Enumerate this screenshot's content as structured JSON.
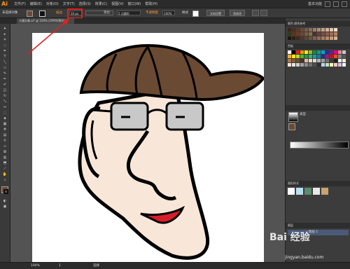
{
  "app": {
    "logo": "Ai"
  },
  "menubar": {
    "items": [
      "文件(F)",
      "编辑(E)",
      "对象(O)",
      "文字(T)",
      "选择(S)",
      "效果(C)",
      "视图(V)",
      "窗口(W)",
      "帮助(H)"
    ],
    "workspace": "基本功能"
  },
  "control_bar": {
    "selection": "未选择对象",
    "stroke_label": "描边",
    "stroke_value": "10 px",
    "profile_label": "等比",
    "brush_label": "5 点圆形",
    "opacity_label": "不透明度",
    "opacity_value": "100%",
    "style_label": "样式",
    "doc_settings": "文档设置",
    "preferences": "首选项"
  },
  "document_tab": {
    "label": "卡通头像.ai* @ 100% (CMYK/预览)"
  },
  "panels": {
    "color_tabs": "颜色  颜色参考",
    "swatches_title": "色板",
    "gradient_type_label": "类型",
    "stroke_title": "描边",
    "graphic_styles_title": "图形样式",
    "layers_title": "图层",
    "layer_name": "图层 1"
  },
  "statusbar": {
    "zoom": "100%",
    "page": "1",
    "tool": "选择"
  },
  "watermark": {
    "text": "Bai 经验",
    "url": "jingyan.baidu.com"
  },
  "colors": {
    "accent_highlight": "#e02020",
    "skin": "#f8e7d8",
    "hat": "#6b4a33",
    "lip": "#d81d2a",
    "stroke": "#000000"
  }
}
